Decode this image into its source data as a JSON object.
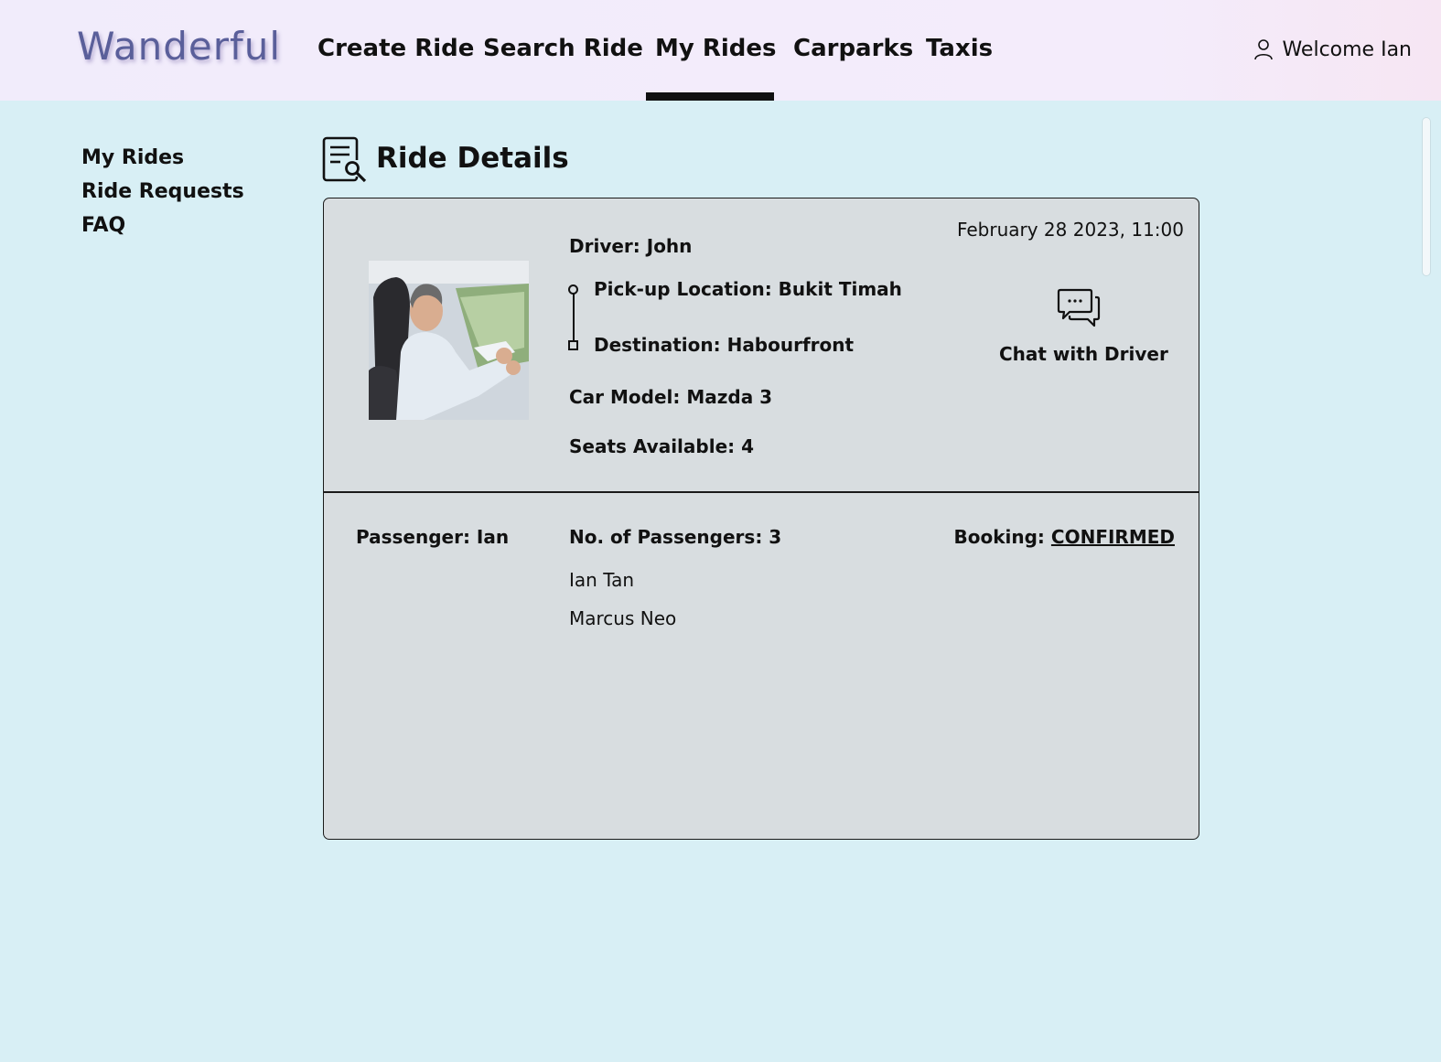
{
  "header": {
    "logo": "Wanderful",
    "nav": [
      "Create Ride",
      "Search Ride",
      "My Rides",
      "Carparks",
      "Taxis"
    ],
    "active_nav": "My Rides",
    "welcome": "Welcome Ian"
  },
  "sidebar": {
    "items": [
      "My Rides",
      "Ride Requests",
      "FAQ"
    ]
  },
  "page": {
    "title": "Ride Details"
  },
  "ride": {
    "datetime": "February 28 2023, 11:00",
    "driver": "Driver: John",
    "pickup": "Pick-up Location: Bukit Timah",
    "destination": "Destination: Habourfront",
    "car_model": "Car Model: Mazda 3",
    "seats": "Seats Available: 4",
    "chat_label": "Chat with Driver"
  },
  "booking": {
    "passenger": "Passenger: Ian",
    "num_passengers": "No. of Passengers: 3",
    "booking_label": "Booking: ",
    "booking_status": "CONFIRMED",
    "passenger_names": [
      "Ian Tan",
      "Marcus Neo"
    ]
  },
  "icons": {
    "user": "user-icon",
    "document": "document-search-icon",
    "chat": "chat-bubbles-icon"
  }
}
